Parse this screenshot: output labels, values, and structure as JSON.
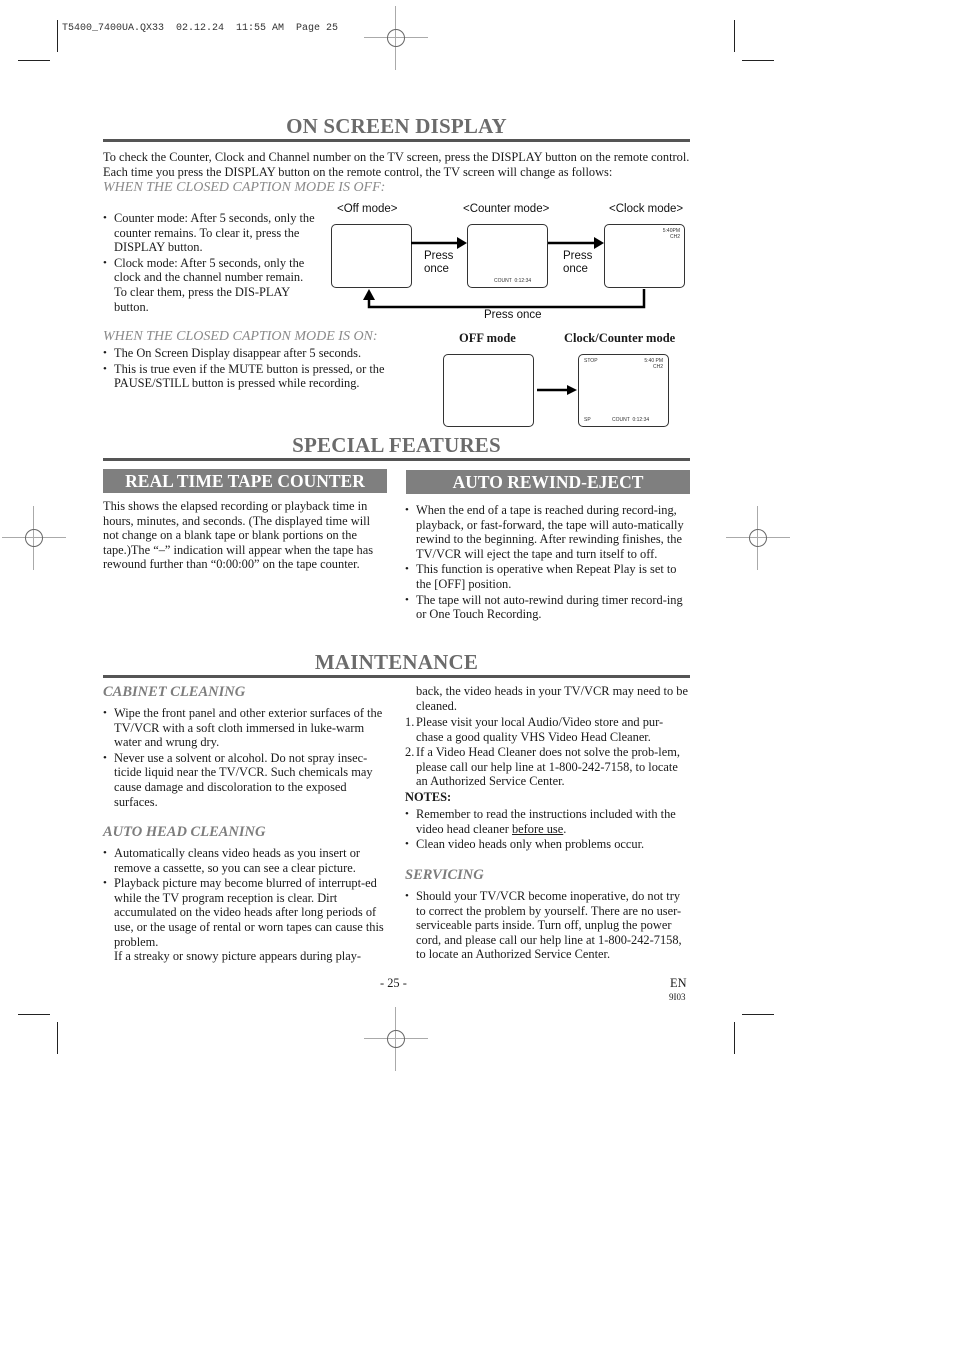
{
  "print_header": {
    "slug": "T5400_7400UA.QX33  02.12.24  11:55 AM  Page 25"
  },
  "on_screen_display": {
    "title": "ON SCREEN DISPLAY",
    "intro": "To check the Counter, Clock and Channel number on the TV screen, press the DISPLAY button on the remote control. Each time you press the DISPLAY button on the remote control, the TV screen will change as follows:",
    "cc_off_heading": "WHEN THE CLOSED CAPTION MODE IS OFF:",
    "cc_off_bullets": [
      "Counter mode: After 5 seconds, only the counter remains. To clear it, press the DISPLAY button.",
      "Clock mode: After 5 seconds, only the clock and the channel number remain. To clear them, press the DIS-PLAY button."
    ],
    "diagram_off": {
      "modes": [
        "<Off mode>",
        "<Counter mode>",
        "<Clock mode>"
      ],
      "press_once_1": [
        "Press",
        "once"
      ],
      "press_once_2": [
        "Press",
        "once"
      ],
      "press_once_return": "Press once",
      "counter_screen_text": "COUNT  0:12:34",
      "clock_screen_time": "5:40PM",
      "clock_screen_channel": "CH2"
    },
    "cc_on_heading": "WHEN THE CLOSED CAPTION MODE IS ON:",
    "cc_on_bullets": [
      "The On Screen Display disappear after 5 seconds.",
      "This is true even if the MUTE button is pressed, or the PAUSE/STILL button is pressed while recording."
    ],
    "diagram_on": {
      "off_label": "OFF mode",
      "clock_counter_label": "Clock/Counter mode",
      "screen_status": "STOP",
      "screen_time": "5:40 PM",
      "screen_channel": "CH2",
      "screen_speed": "SP",
      "screen_counter": "COUNT  0:12:34"
    }
  },
  "special_features": {
    "title": "SPECIAL FEATURES",
    "tape_counter": {
      "heading": "REAL TIME TAPE COUNTER",
      "body": "This shows the elapsed recording or playback time in hours, minutes, and seconds. (The displayed time will not change on a blank tape or blank portions on the tape.)The “–” indication will appear when the tape has rewound further than “0:00:00” on the tape counter."
    },
    "auto_rewind": {
      "heading": "AUTO REWIND-EJECT",
      "bullets": [
        "When the end of a tape is reached during record-ing, playback, or fast-forward, the tape will auto-matically rewind to the beginning. After rewinding finishes, the TV/VCR will eject the tape and turn itself to off.",
        "This function is operative when Repeat Play is set to the [OFF] position.",
        "The tape will not auto-rewind during timer record-ing or One Touch Recording."
      ]
    }
  },
  "maintenance": {
    "title": "MAINTENANCE",
    "cabinet_cleaning": {
      "heading": "CABINET CLEANING",
      "bullets": [
        "Wipe the front panel and other exterior surfaces of the TV/VCR with a soft cloth immersed in luke-warm water and wrung dry.",
        "Never use a solvent or alcohol. Do not spray insec-ticide liquid near the TV/VCR. Such chemicals may cause damage and discoloration to the exposed surfaces."
      ]
    },
    "auto_head_cleaning": {
      "heading": "AUTO HEAD CLEANING",
      "bullets": [
        "Automatically cleans video heads as you insert or remove a cassette, so you can see a clear picture.",
        "Playback picture may become blurred of interrupt-ed while the TV program reception is clear. Dirt accumulated on the video heads after long periods of use, or the usage of rental or worn tapes can cause this problem."
      ],
      "continuation": "If a streaky or snowy picture appears during play-back, the video heads in your TV/VCR may need to be cleaned.",
      "continuation_part1": "If a streaky or snowy picture appears during play-",
      "continuation_part2": "back, the video heads in your TV/VCR may need to be cleaned.",
      "steps": [
        {
          "num": "1.",
          "text": "Please visit your local Audio/Video store and pur-chase a good quality VHS Video Head Cleaner."
        },
        {
          "num": "2.",
          "text": "If a Video Head Cleaner does not solve the prob-lem, please call our help line at 1-800-242-7158, to locate an Authorized Service Center."
        }
      ],
      "notes_label": "NOTES:",
      "note1_before": "Remember to read the instructions included with the video head cleaner ",
      "note1_underlined": "before use",
      "note1_after": ".",
      "note2": "Clean video heads only when problems occur."
    },
    "servicing": {
      "heading": "SERVICING",
      "bullets": [
        "Should your TV/VCR become inoperative, do not try to correct the problem by yourself. There are no user-serviceable parts inside. Turn off, unplug the power cord, and please call our help line at 1-800-242-7158, to locate an Authorized Service Center."
      ]
    }
  },
  "footer": {
    "page_number": "- 25 -",
    "language": "EN",
    "code": "9I03"
  }
}
